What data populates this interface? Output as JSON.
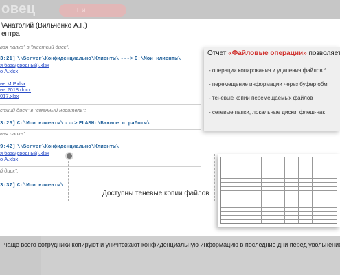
{
  "header": {
    "brand": "овец",
    "pill_label": "Т        и"
  },
  "card": {
    "user_line": "\\Анатолий (Вильченко А.Г.)",
    "subtitle": "ентра"
  },
  "log": {
    "section1_title": "вая папка\" в \"жесткий диск\":",
    "section1_time": "3:21]",
    "section1_path": "\\\\Server\\Конфиденциально\\Клиенты\\",
    "section1_arrow": "--->",
    "section1_dest": "C:\\Мои клиенты\\",
    "files1": [
      "я база(сводный).xlsx",
      "о А.xlsx",
      "",
      "ин М.Р.xlsx",
      " на 2018.docx",
      "017.xlsx"
    ],
    "section2_title": "сткий диск\" в \"сменный носитель\":",
    "section2_time": "3:26]",
    "section2_path": "C:\\Мои клиенты\\",
    "section2_arrow": "--->",
    "section2_dest": "FLASH:\\Важное с работы\\",
    "section3_title": "вая папка\":",
    "section3_time": "9:42]",
    "section3_path": "\\\\Server\\Конфиденциально\\Клиенты\\",
    "files3": [
      "я база(сводный).xlsx",
      "о А.xlsx"
    ],
    "section4_title": "й диск\":",
    "section4_time": "3:37]",
    "section4_path": "C:\\Мои клиенты\\"
  },
  "info": {
    "title_prefix": "Отчет ",
    "title_bold": "«Файловые операции»",
    "title_suffix": " позволяет",
    "items": [
      "- операции копирования и удаления файлов *",
      "- перемещение информации через буфер обм",
      "- теневые копии перемещаемых файлов",
      "- сетевые папки, локальные диски, флеш-нак"
    ]
  },
  "callout": "Доступны теневые копии файлов",
  "footer": "чаще всего сотрудники копируют и уничтожают конфиденциальную информацию в последние дни перед увольнение"
}
